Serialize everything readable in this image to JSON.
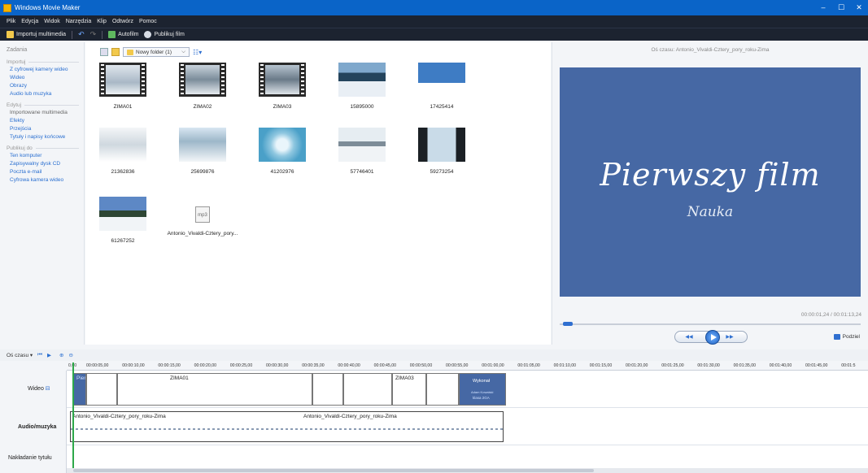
{
  "window": {
    "title": "Windows Movie Maker",
    "min": "–",
    "max": "☐",
    "close": "✕"
  },
  "menu": [
    "Plik",
    "Edycja",
    "Widok",
    "Narzędzia",
    "Klip",
    "Odtwórz",
    "Pomoc"
  ],
  "toolbar": {
    "import": "Importuj multimedia",
    "autofilm": "Autofilm",
    "publish": "Publikuj film"
  },
  "tasks": {
    "header": "Zadania",
    "groups": [
      {
        "title": "Importuj",
        "links": [
          "Z cyfrowej kamery wideo",
          "Wideo",
          "Obrazy",
          "Audio lub muzyka"
        ]
      },
      {
        "title": "Edytuj",
        "links": [
          "Importowane multimedia",
          "Efekty",
          "Przejścia",
          "Tytuły i napisy końcowe"
        ]
      },
      {
        "title": "Publikuj do",
        "links": [
          "Ten komputer",
          "Zapisywalny dysk CD",
          "Poczta e-mail",
          "Cyfrowa kamera wideo"
        ]
      }
    ]
  },
  "collection": {
    "folder": "Nowy folder (1)",
    "items": [
      "ZIMA01",
      "ZIMA02",
      "ZIMA03",
      "15895000",
      "17425414",
      "21362836",
      "25699876",
      "41202976",
      "57746401",
      "59273254",
      "61267252",
      "Antonio_Vivaldi-Cztery_pory..."
    ],
    "audio_badge": "mp3"
  },
  "preview": {
    "title": "Oś czasu: Antonio_Vivaldi-Cztery_pory_roku-Zima",
    "big_text": "Pierwszy film",
    "small_text": "Nauka",
    "time": "00:00:01,24 / 00:01:13,24",
    "split": "Podziel",
    "progress": 0.01
  },
  "timeline": {
    "mode": "Oś czasu",
    "ruler": [
      "0,00",
      "00:00:05,00",
      "00:00:10,00",
      "00:00:15,00",
      "00:00:20,00",
      "00:00:25,00",
      "00:00:30,00",
      "00:00:35,00",
      "00:00:40,00",
      "00:00:45,00",
      "00:00:50,00",
      "00:00:55,00",
      "00:01:00,00",
      "00:01:05,00",
      "00:01:10,00",
      "00:01:15,00",
      "00:01:20,00",
      "00:01:25,00",
      "00:01:30,00",
      "00:01:35,00",
      "00:01:40,00",
      "00:01:45,00",
      "00:01:5"
    ],
    "tracks": {
      "video": "Wideo",
      "audio": "Audio/muzyka",
      "title": "Nakładanie tytułu"
    },
    "clips": {
      "c1": "Pier",
      "c2": "ZIMA01",
      "c3": "ZIMA03",
      "c4": "Wykonał",
      "c4b": "Adam Kowalski",
      "c4c": "klasa 2GA"
    },
    "audio_clips": [
      "Antonio_Vivaldi-Cztery_pory_roku-Zima",
      "Antonio_Vivaldi-Cztery_pory_roku-Zima"
    ]
  },
  "colors": {
    "accent": "#0a64c8",
    "preview_bg": "#4668a4",
    "playhead": "#2ea84a"
  }
}
